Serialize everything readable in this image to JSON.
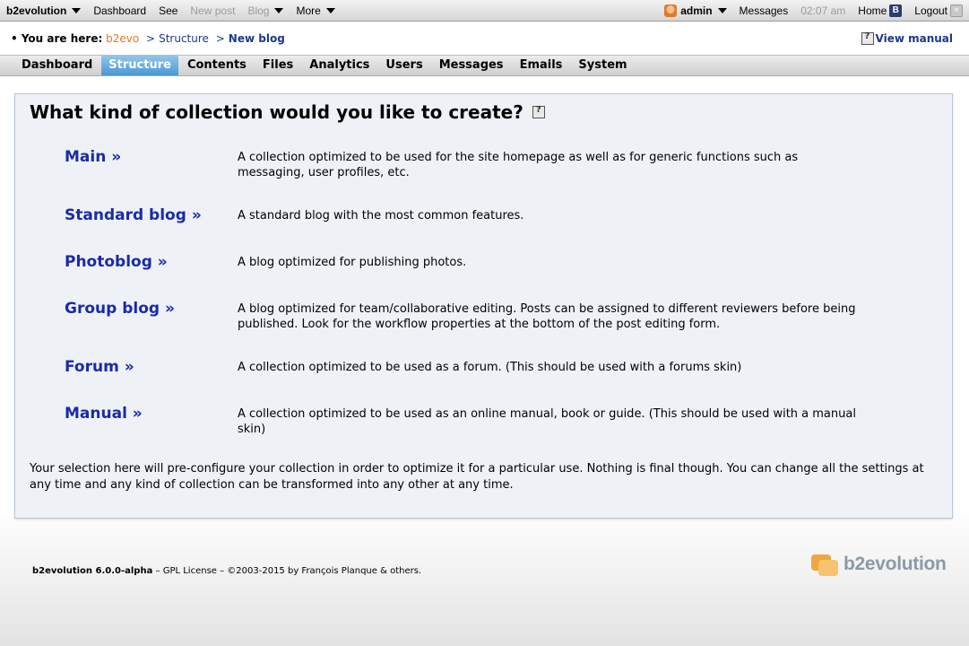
{
  "evobar": {
    "site": "b2evolution",
    "dashboard": "Dashboard",
    "see": "See",
    "new_post": "New post",
    "blog": "Blog",
    "more": "More",
    "user": "admin",
    "messages": "Messages",
    "time": "02:07 am",
    "home": "Home",
    "home_badge": "B",
    "logout": "Logout",
    "logout_badge": "×"
  },
  "breadcrumb": {
    "prefix": "• You are here:",
    "root": "b2evo",
    "sep": ">",
    "level1": "Structure",
    "current": "New blog",
    "manual": "View manual"
  },
  "tabs": [
    {
      "label": "Dashboard",
      "active": false
    },
    {
      "label": "Structure",
      "active": true
    },
    {
      "label": "Contents",
      "active": false
    },
    {
      "label": "Files",
      "active": false
    },
    {
      "label": "Analytics",
      "active": false
    },
    {
      "label": "Users",
      "active": false
    },
    {
      "label": "Messages",
      "active": false
    },
    {
      "label": "Emails",
      "active": false
    },
    {
      "label": "System",
      "active": false
    }
  ],
  "main": {
    "title": "What kind of collection would you like to create?",
    "kinds": [
      {
        "label": "Main »",
        "desc": "A collection optimized to be used for the site homepage as well as for generic functions such as messaging, user profiles, etc."
      },
      {
        "label": "Standard blog »",
        "desc": "A standard blog with the most common features."
      },
      {
        "label": "Photoblog »",
        "desc": "A blog optimized for publishing photos."
      },
      {
        "label": "Group blog »",
        "desc": "A blog optimized for team/collaborative editing. Posts can be assigned to different reviewers before being published. Look for the workflow properties at the bottom of the post editing form."
      },
      {
        "label": "Forum »",
        "desc": "A collection optimized to be used as a forum. (This should be used with a forums skin)"
      },
      {
        "label": "Manual »",
        "desc": "A collection optimized to be used as an online manual, book or guide. (This should be used with a manual skin)"
      }
    ],
    "note": "Your selection here will pre-configure your collection in order to optimize it for a particular use. Nothing is final though. You can change all the settings at any time and any kind of collection can be transformed into any other at any time."
  },
  "footer": {
    "version": "b2evolution 6.0.0-alpha",
    "rest": " – GPL License – ©2003-2015 by François Planque & others.",
    "logo": "b2evolution"
  },
  "colors": {
    "link": "#1a2aa8",
    "tab_active": "#4a98d3",
    "panel_bg": "#eef2f6",
    "orange": "#e07a1f"
  }
}
